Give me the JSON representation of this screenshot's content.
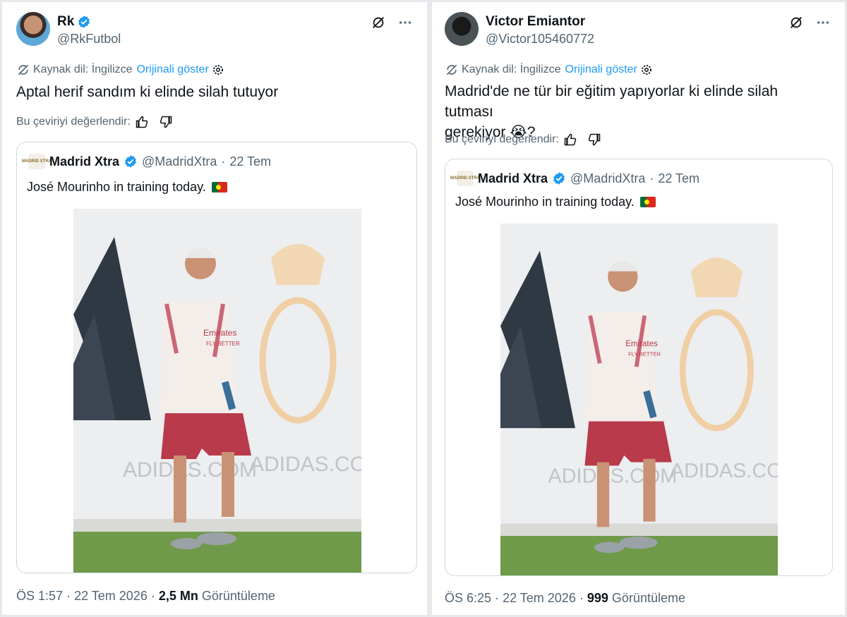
{
  "left": {
    "user": {
      "name": "Rk",
      "handle": "@RkFutbol"
    },
    "translation": {
      "source_label": "Kaynak dil: İngilizce",
      "show_original": "Orijinali göster"
    },
    "text": "Aptal herif sandım ki elinde silah tutuyor",
    "rate_label": "Bu çeviriyi değerlendir:",
    "quote": {
      "name": "Madrid Xtra",
      "handle": "@MadridXtra",
      "sep": "·",
      "date": "22 Tem",
      "text": "José Mourinho in training today.",
      "logo_text": "MADRID XTRA"
    },
    "footer": {
      "time": "ÖS 1:57",
      "sep1": "·",
      "date": "22 Tem 2026",
      "sep2": "·",
      "views": "2,5 Mn",
      "views_label": "Görüntüleme"
    }
  },
  "right": {
    "user": {
      "name": "Victor Emiantor",
      "handle": "@Victor105460772"
    },
    "translation": {
      "source_label": "Kaynak dil: İngilizce",
      "show_original": "Orijinali göster"
    },
    "text_line1": "Madrid'de ne tür bir eğitim yapıyorlar ki elinde silah tutması",
    "text_line2": "gerekiyor 😭?",
    "rate_label": "Bu çeviriyi değerlendir:",
    "quote": {
      "name": "Madrid Xtra",
      "handle": "@MadridXtra",
      "sep": "·",
      "date": "22 Tem",
      "text": "José Mourinho in training today.",
      "logo_text": "MADRID XTRA"
    },
    "footer": {
      "time": "ÖS 6:25",
      "sep1": "·",
      "date": "22 Tem 2026",
      "sep2": "·",
      "views": "999",
      "views_label": "Görüntüleme"
    }
  },
  "photo_text": {
    "brand1": "ADIDAS.COM",
    "brand2": "ADIDAS.COM",
    "shirt": "Emirates",
    "shirt2": "FLY BETTER"
  },
  "colors": {
    "accent": "#1d9bf0",
    "muted": "#536471",
    "border": "#cfd9de",
    "kit_pink": "#e6a3b1",
    "kit_shorts": "#b83a4b"
  },
  "icons": [
    "verified-badge-icon",
    "grok-icon",
    "more-icon",
    "translate-icon",
    "settings-icon",
    "thumbs-up-icon",
    "thumbs-down-icon",
    "portugal-flag-icon"
  ]
}
